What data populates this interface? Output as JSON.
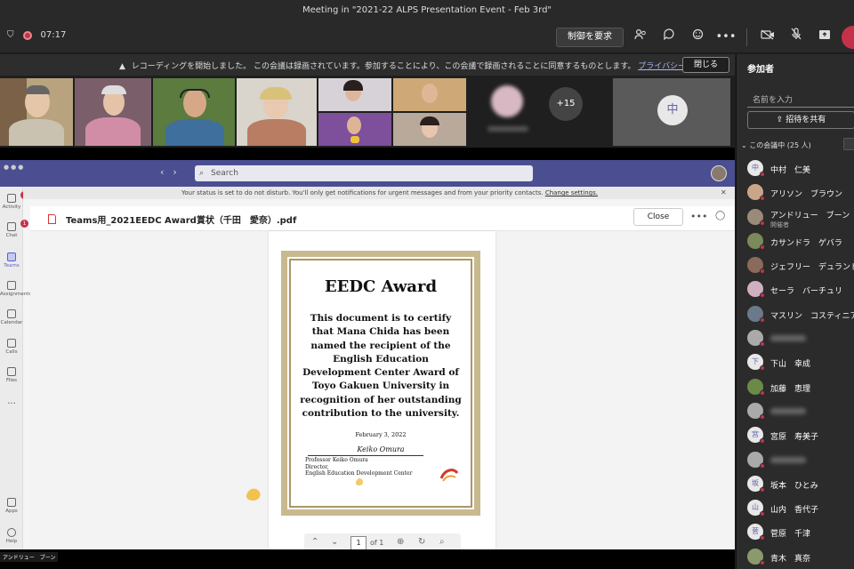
{
  "window": {
    "title": "Meeting in \"2021-22 ALPS Presentation Event - Feb 3rd\""
  },
  "meeting": {
    "timer": "07:17",
    "request_control_label": "制御を要求"
  },
  "recording_notice": {
    "text": "レコーディングを開始しました。 この会議は録画されています。参加することにより、この会議で録画されることに同意するものとします。",
    "privacy_link": "プライバシー ポリシー",
    "dismiss_label": "閉じる"
  },
  "video_strip": {
    "overflow_count": "+15",
    "featured_initial": "中"
  },
  "participants": {
    "title": "参加者",
    "search_placeholder": "名前を入力",
    "share_invite_label": "招待を共有",
    "section_label": "この会議中 (25 人)",
    "list": [
      {
        "name": "中村　仁美",
        "initial": "中",
        "sub": ""
      },
      {
        "name": "アリソン　ブラウン",
        "initial": "",
        "sub": ""
      },
      {
        "name": "アンドリュー　ブーン",
        "initial": "",
        "sub": "開催者"
      },
      {
        "name": "カサンドラ　ゲバラ",
        "initial": "",
        "sub": ""
      },
      {
        "name": "ジェフリー　デュランド",
        "initial": "",
        "sub": ""
      },
      {
        "name": "セーラ　バーチュリ",
        "initial": "",
        "sub": ""
      },
      {
        "name": "マスリン　コスティニアーノ",
        "initial": "",
        "sub": ""
      },
      {
        "name": "",
        "initial": "",
        "sub": ""
      },
      {
        "name": "下山　幸成",
        "initial": "下",
        "sub": ""
      },
      {
        "name": "加藤　恵理",
        "initial": "",
        "sub": ""
      },
      {
        "name": "",
        "initial": "",
        "sub": ""
      },
      {
        "name": "宮原　寿美子",
        "initial": "宮",
        "sub": ""
      },
      {
        "name": "",
        "initial": "",
        "sub": ""
      },
      {
        "name": "坂本　ひとみ",
        "initial": "坂",
        "sub": ""
      },
      {
        "name": "山内　香代子",
        "initial": "山",
        "sub": ""
      },
      {
        "name": "菅原　千津",
        "initial": "菅",
        "sub": ""
      },
      {
        "name": "青木　真奈",
        "initial": "",
        "sub": ""
      }
    ]
  },
  "teams": {
    "search_placeholder": "Search",
    "dnd_banner": "Your status is set to do not disturb. You'll only get notifications for urgent messages and from your priority contacts.",
    "dnd_link": "Change settings.",
    "rail": {
      "activity": "Activity",
      "chat": "Chat",
      "teams": "Teams",
      "assignments": "Assignments",
      "calendar": "Calendar",
      "calls": "Calls",
      "files": "Files",
      "more": "...",
      "apps": "Apps",
      "help": "Help",
      "activity_badge": "1",
      "chat_badge": "1"
    },
    "document": {
      "title": "Teams用_2021EEDC Award賞状（千田　愛奈）.pdf",
      "close_label": "Close"
    },
    "pager": {
      "page": "1",
      "of": "of 1"
    }
  },
  "certificate": {
    "title": "EEDC Award",
    "body": [
      "This document is to certify",
      "that Mana Chida has been",
      "named the recipient of the",
      "English Education",
      "Development Center Award of",
      "Toyo Gakuen University in",
      "recognition of her outstanding",
      "contribution to the university."
    ],
    "date": "February 3, 2022",
    "signature": "Keiko Omura",
    "signer": "Professor Keiko Omura",
    "signer_title": "Director,",
    "signer_org": "English Education Development Center"
  },
  "presenter_label": "アンドリュー　ブーン",
  "colors": {
    "teams_purple": "#4b4f91",
    "record_red": "#c4314b",
    "cert_border": "#c9b98e"
  }
}
